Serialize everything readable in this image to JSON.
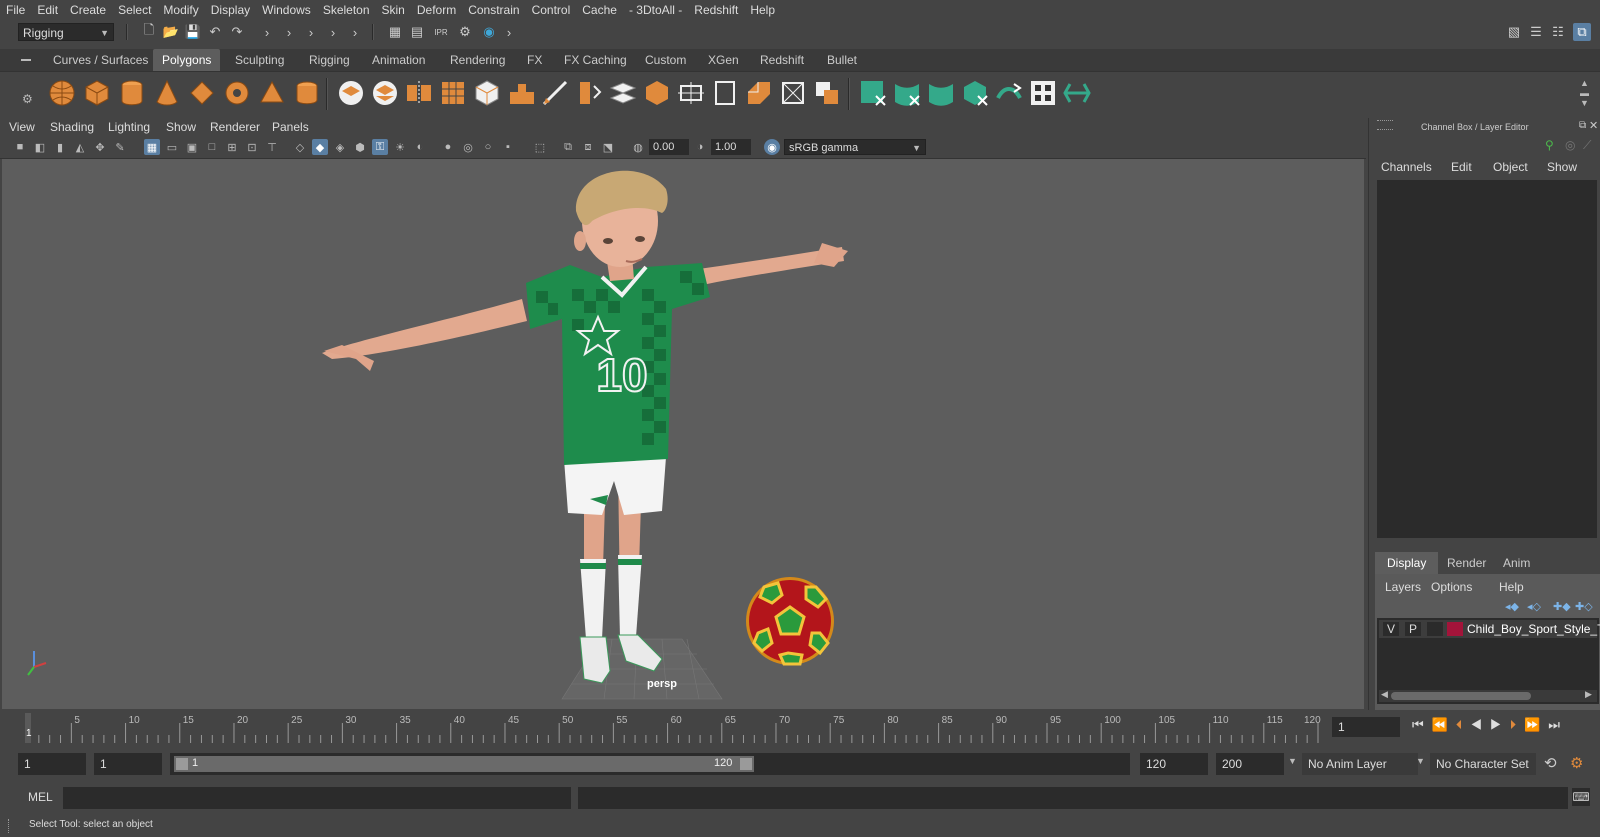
{
  "menubar": [
    "File",
    "Edit",
    "Create",
    "Select",
    "Modify",
    "Display",
    "Windows",
    "Skeleton",
    "Skin",
    "Deform",
    "Constrain",
    "Control",
    "Cache",
    "- 3DtoAll -",
    "Redshift",
    "Help"
  ],
  "statusline": {
    "menu_set": "Rigging"
  },
  "shelf": {
    "tabs": [
      "Curves / Surfaces",
      "Polygons",
      "Sculpting",
      "Rigging",
      "Animation",
      "Rendering",
      "FX",
      "FX Caching",
      "Custom",
      "XGen",
      "Redshift",
      "Bullet"
    ],
    "active_tab": "Polygons"
  },
  "viewport": {
    "menu": [
      "View",
      "Shading",
      "Lighting",
      "Show",
      "Renderer",
      "Panels"
    ],
    "exposure": "0.00",
    "gamma": "1.00",
    "color_space": "sRGB gamma",
    "camera_label": "persp",
    "jersey_number": "10"
  },
  "right_panel": {
    "title": "Channel Box / Layer Editor",
    "channel_menu": [
      "Channels",
      "Edit",
      "Object",
      "Show"
    ],
    "layer_tabs": [
      "Display",
      "Render",
      "Anim"
    ],
    "active_layer_tab": "Display",
    "layer_menu": [
      "Layers",
      "Options",
      "Help"
    ],
    "layer": {
      "v": "V",
      "p": "P",
      "name": "Child_Boy_Sport_Style_TI",
      "color": "#a3143a"
    }
  },
  "timeline": {
    "ticks": [
      "5",
      "10",
      "15",
      "20",
      "25",
      "30",
      "35",
      "40",
      "45",
      "50",
      "55",
      "60",
      "65",
      "70",
      "75",
      "80",
      "85",
      "90",
      "95",
      "100",
      "105",
      "110",
      "115",
      "120"
    ],
    "current_frame_marker": "1",
    "current_frame": "1"
  },
  "range": {
    "start": "1",
    "playback_start": "1",
    "slider_start": "1",
    "slider_end": "120",
    "playback_end": "120",
    "end": "200",
    "anim_layer": "No Anim Layer",
    "character_set": "No Character Set"
  },
  "command": {
    "label": "MEL"
  },
  "help_line": "Select Tool: select an object"
}
